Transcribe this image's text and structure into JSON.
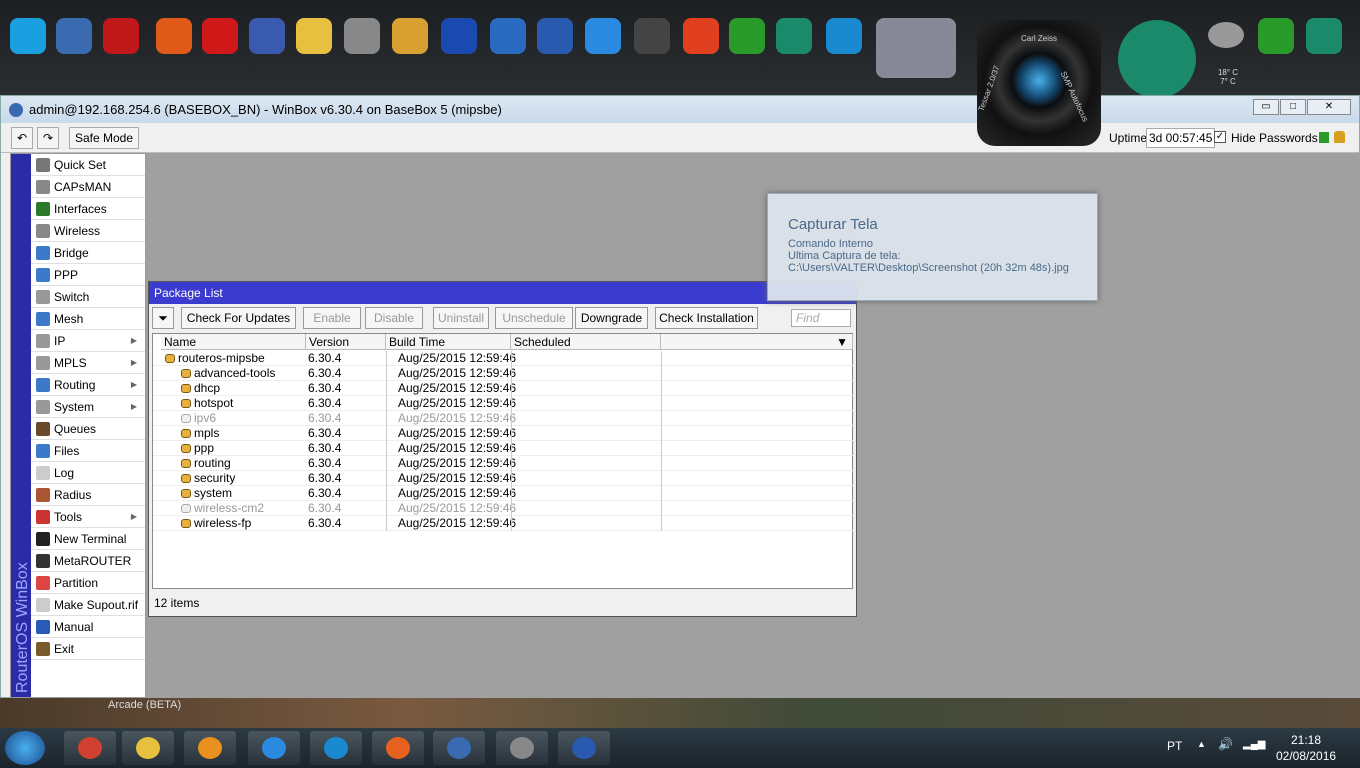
{
  "desktop": {
    "icons": [
      "skype",
      "computer",
      "kaspersky",
      "ccleaner",
      "mega",
      "dropbox-like",
      "folder",
      "recycle-bin",
      "control-panel",
      "malwarebytes",
      "google-earth",
      "word",
      "flash",
      "hp",
      "power",
      "utorrent-green",
      "iobit",
      "ccleaner-blue",
      "itunes-dvd",
      "camera-capture",
      "iobit-shield",
      "weather",
      "utorrent",
      "iobit-small"
    ],
    "camera_text": {
      "brand": "Carl Zeiss",
      "left": "Tessar 2.0/37",
      "right": "SMP Autofocus"
    },
    "weather": {
      "temp": "18° C",
      "low": "7° C"
    },
    "background_label": "Arcade (BETA)"
  },
  "window": {
    "title": "admin@192.168.254.6 (BASEBOX_BN) - WinBox v6.30.4 on BaseBox 5 (mipsbe)",
    "minimize": "▭",
    "maximize": "□",
    "close": "✕"
  },
  "toolbar": {
    "undo": "↶",
    "redo": "↷",
    "safe_mode": "Safe Mode",
    "uptime_label": "Uptime:",
    "uptime": "3d 00:57:45",
    "hide_passwords": "Hide Passwords",
    "hide_passwords_checked": true
  },
  "sidebar": {
    "brand": "RouterOS WinBox",
    "items": [
      {
        "label": "Quick Set",
        "color": "#777"
      },
      {
        "label": "CAPsMAN",
        "color": "#888"
      },
      {
        "label": "Interfaces",
        "color": "#2a7a2a"
      },
      {
        "label": "Wireless",
        "color": "#888"
      },
      {
        "label": "Bridge",
        "color": "#3a7ac8"
      },
      {
        "label": "PPP",
        "color": "#3a7ac8"
      },
      {
        "label": "Switch",
        "color": "#999"
      },
      {
        "label": "Mesh",
        "color": "#3a7ac8"
      },
      {
        "label": "IP",
        "color": "#999",
        "submenu": true
      },
      {
        "label": "MPLS",
        "color": "#999",
        "submenu": true
      },
      {
        "label": "Routing",
        "color": "#3a7ac8",
        "submenu": true
      },
      {
        "label": "System",
        "color": "#999",
        "submenu": true
      },
      {
        "label": "Queues",
        "color": "#6a4a2a"
      },
      {
        "label": "Files",
        "color": "#3a7ac8"
      },
      {
        "label": "Log",
        "color": "#ccc"
      },
      {
        "label": "Radius",
        "color": "#a53"
      },
      {
        "label": "Tools",
        "color": "#c33",
        "submenu": true
      },
      {
        "label": "New Terminal",
        "color": "#222"
      },
      {
        "label": "MetaROUTER",
        "color": "#333"
      },
      {
        "label": "Partition",
        "color": "#d44"
      },
      {
        "label": "Make Supout.rif",
        "color": "#ccc"
      },
      {
        "label": "Manual",
        "color": "#2a5ab8"
      },
      {
        "label": "Exit",
        "color": "#7a5a2a"
      }
    ]
  },
  "package_list": {
    "title": "Package List",
    "buttons": [
      {
        "label": "Check For Updates",
        "enabled": true
      },
      {
        "label": "Enable",
        "enabled": false
      },
      {
        "label": "Disable",
        "enabled": false
      },
      {
        "label": "Uninstall",
        "enabled": false
      },
      {
        "label": "Unschedule",
        "enabled": false
      },
      {
        "label": "Downgrade",
        "enabled": true
      },
      {
        "label": "Check Installation",
        "enabled": true
      }
    ],
    "find_placeholder": "Find",
    "columns": [
      "Name",
      "Version",
      "Build Time",
      "Scheduled"
    ],
    "rows": [
      {
        "name": "routeros-mipsbe",
        "version": "6.30.4",
        "build": "Aug/25/2015 12:59:46",
        "scheduled": "",
        "child": false,
        "disabled": false
      },
      {
        "name": "advanced-tools",
        "version": "6.30.4",
        "build": "Aug/25/2015 12:59:46",
        "scheduled": "",
        "child": true,
        "disabled": false
      },
      {
        "name": "dhcp",
        "version": "6.30.4",
        "build": "Aug/25/2015 12:59:46",
        "scheduled": "",
        "child": true,
        "disabled": false
      },
      {
        "name": "hotspot",
        "version": "6.30.4",
        "build": "Aug/25/2015 12:59:46",
        "scheduled": "",
        "child": true,
        "disabled": false
      },
      {
        "name": "ipv6",
        "version": "6.30.4",
        "build": "Aug/25/2015 12:59:46",
        "scheduled": "",
        "child": true,
        "disabled": true
      },
      {
        "name": "mpls",
        "version": "6.30.4",
        "build": "Aug/25/2015 12:59:46",
        "scheduled": "",
        "child": true,
        "disabled": false
      },
      {
        "name": "ppp",
        "version": "6.30.4",
        "build": "Aug/25/2015 12:59:46",
        "scheduled": "",
        "child": true,
        "disabled": false
      },
      {
        "name": "routing",
        "version": "6.30.4",
        "build": "Aug/25/2015 12:59:46",
        "scheduled": "",
        "child": true,
        "disabled": false
      },
      {
        "name": "security",
        "version": "6.30.4",
        "build": "Aug/25/2015 12:59:46",
        "scheduled": "",
        "child": true,
        "disabled": false
      },
      {
        "name": "system",
        "version": "6.30.4",
        "build": "Aug/25/2015 12:59:46",
        "scheduled": "",
        "child": true,
        "disabled": false
      },
      {
        "name": "wireless-cm2",
        "version": "6.30.4",
        "build": "Aug/25/2015 12:59:46",
        "scheduled": "",
        "child": true,
        "disabled": true
      },
      {
        "name": "wireless-fp",
        "version": "6.30.4",
        "build": "Aug/25/2015 12:59:46",
        "scheduled": "",
        "child": true,
        "disabled": false
      }
    ],
    "status": "12 items"
  },
  "tooltip": {
    "title": "Capturar Tela",
    "line1": "Comando Interno",
    "line2": "Ultima Captura de tela:",
    "line3": "C:\\Users\\VALTER\\Desktop\\Screenshot (20h 32m 48s).jpg"
  },
  "taskbar": {
    "apps": [
      "start",
      "chrome",
      "explorer",
      "media-player",
      "internet-explorer",
      "ccleaner",
      "firefox",
      "app-blue",
      "calculator",
      "winbox"
    ],
    "lang": "PT",
    "time": "21:18",
    "date": "02/08/2016"
  }
}
